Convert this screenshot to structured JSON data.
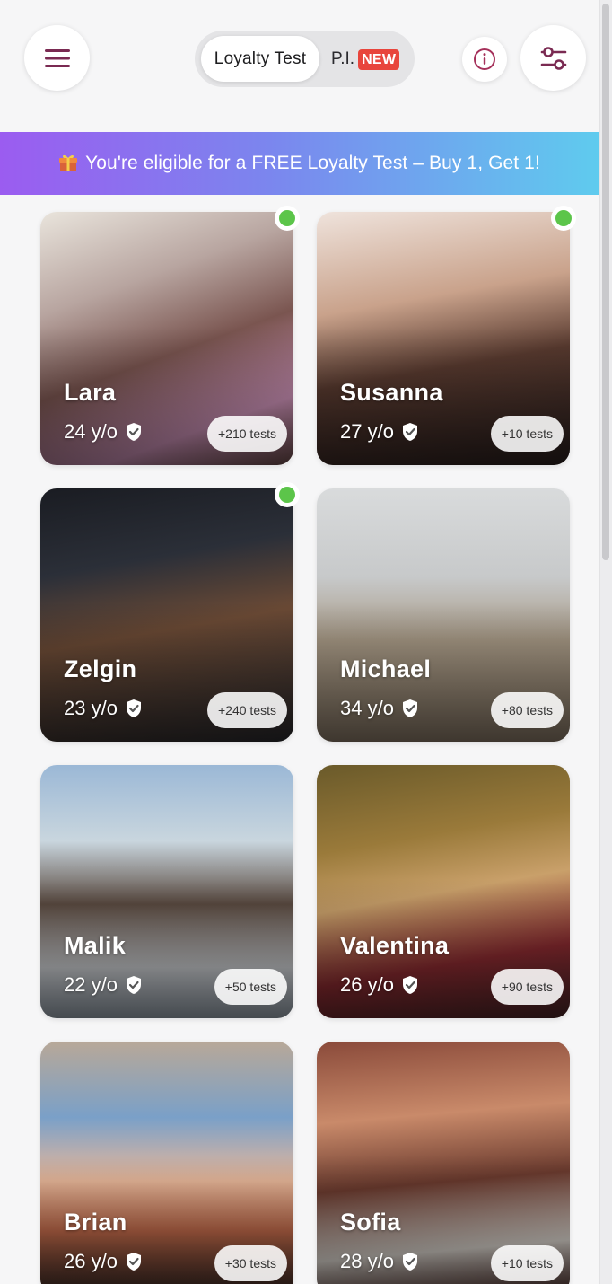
{
  "header": {
    "menu_icon": "hamburger-menu-icon",
    "tabs": [
      {
        "label": "Loyalty Test",
        "active": true
      },
      {
        "label": "P.I.",
        "badge": "NEW",
        "active": false
      }
    ],
    "info_icon": "info-icon",
    "filter_icon": "sliders-filter-icon"
  },
  "promo": {
    "icon": "gift-icon",
    "text": "You're eligible for a FREE Loyalty Test – Buy 1, Get 1!"
  },
  "colors": {
    "accent": "#7a2a52",
    "online": "#5cc54a",
    "badge": "#e8453c",
    "promo_start": "#9b5cf0",
    "promo_end": "#5fcbee"
  },
  "profiles": [
    {
      "name": "Lara",
      "age": "24 y/o",
      "tests": "+210 tests",
      "online": true,
      "verified": true
    },
    {
      "name": "Susanna",
      "age": "27 y/o",
      "tests": "+10 tests",
      "online": true,
      "verified": true
    },
    {
      "name": "Zelgin",
      "age": "23 y/o",
      "tests": "+240 tests",
      "online": true,
      "verified": true
    },
    {
      "name": "Michael",
      "age": "34 y/o",
      "tests": "+80 tests",
      "online": false,
      "verified": true
    },
    {
      "name": "Malik",
      "age": "22 y/o",
      "tests": "+50 tests",
      "online": false,
      "verified": true
    },
    {
      "name": "Valentina",
      "age": "26 y/o",
      "tests": "+90 tests",
      "online": false,
      "verified": true
    },
    {
      "name": "Brian",
      "age": "26 y/o",
      "tests": "+30 tests",
      "online": false,
      "verified": true
    },
    {
      "name": "Sofia",
      "age": "28 y/o",
      "tests": "+10 tests",
      "online": false,
      "verified": true
    }
  ]
}
